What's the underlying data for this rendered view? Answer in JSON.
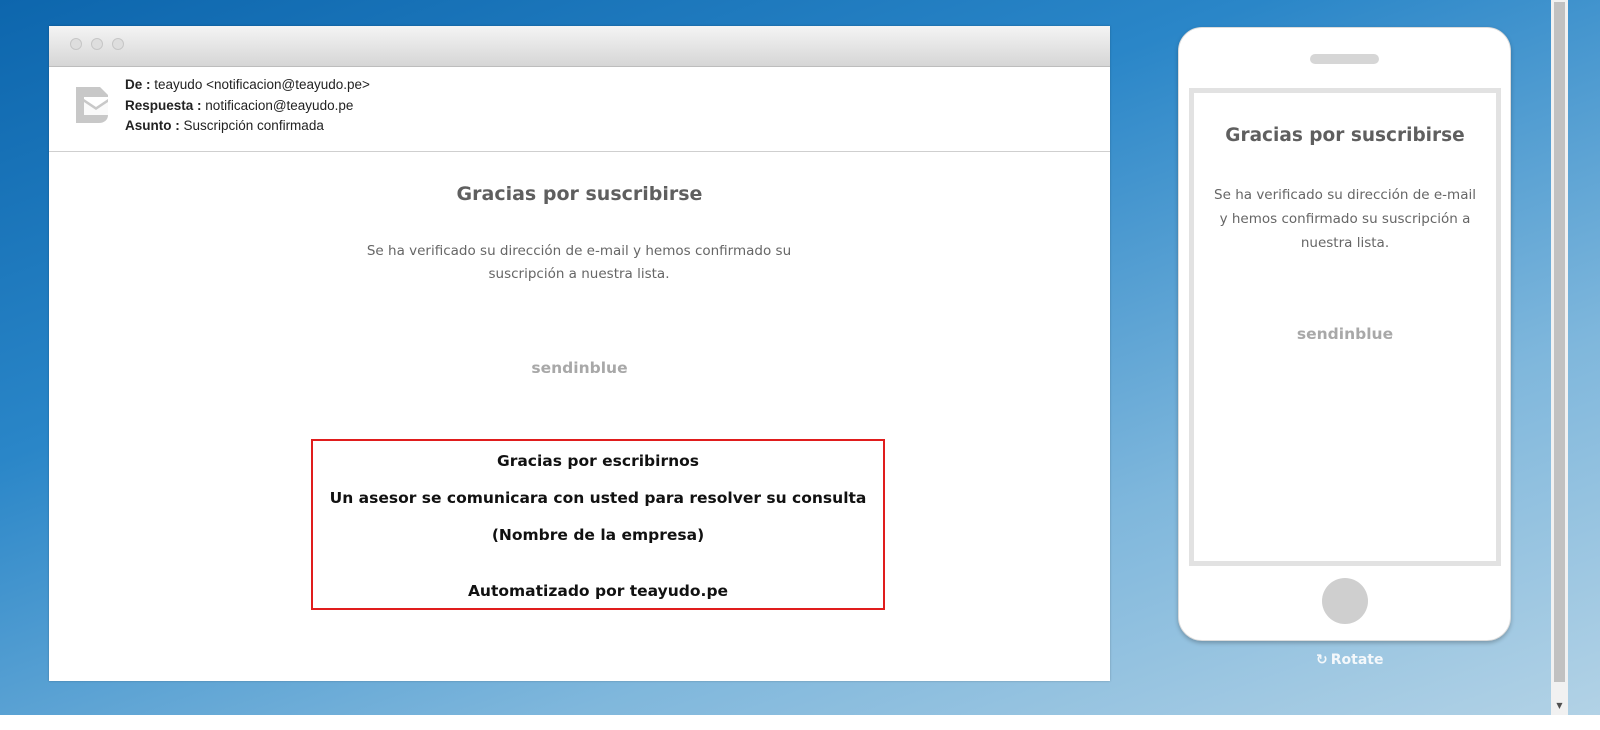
{
  "email": {
    "from_label": "De :",
    "from_value": "teayudo <notificacion@teayudo.pe>",
    "reply_label": "Respuesta :",
    "reply_value": "notificacion@teayudo.pe",
    "subject_label": "Asunto :",
    "subject_value": "Suscripción confirmada",
    "title": "Gracias por suscribirse",
    "text": "Se ha verificado su dirección de e-mail y hemos confirmado su suscripción a nuestra lista.",
    "brand": "sendinblue",
    "box": {
      "line1": "Gracias por escribirnos",
      "line2": "Un asesor se comunicara con usted para resolver su consulta",
      "line3": "(Nombre de la empresa)",
      "line4": "Automatizado por teayudo.pe"
    }
  },
  "phone": {
    "title": "Gracias por suscribirse",
    "text": "Se ha verificado su dirección de e-mail y hemos confirmado su suscripción a nuestra lista.",
    "brand": "sendinblue"
  },
  "rotate_label": "Rotate",
  "icons": {
    "envelope": "envelope-icon",
    "rotate": "rotate-icon"
  },
  "colors": {
    "highlight_border": "#e01d1d",
    "brand_gray": "#a8a8a8"
  }
}
